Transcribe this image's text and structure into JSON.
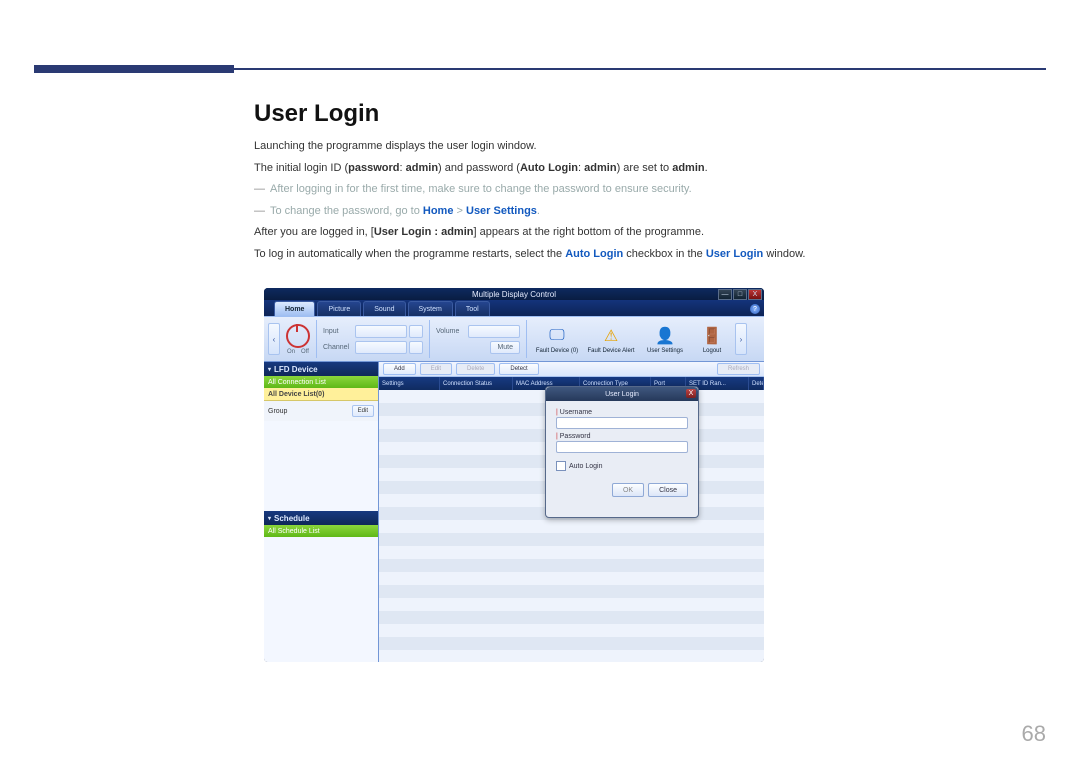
{
  "doc": {
    "heading": "User Login",
    "p1": "Launching the programme displays the user login window.",
    "p2_before": "The initial login ID (",
    "p2_pwd": "password",
    "p2_mid1": ": ",
    "p2_admin1": "admin",
    "p2_mid2": ") and password (",
    "p2_auto": "Auto Login",
    "p2_mid3": ": ",
    "p2_admin2": "admin",
    "p2_mid4": ") are set to ",
    "p2_admin3": "admin",
    "p2_end": ".",
    "dim1": "After logging in for the first time, make sure to change the password to ensure security.",
    "dim2_pre": "To change the password, go to ",
    "dim2_home": "Home",
    "dim2_gt": " > ",
    "dim2_us": "User Settings",
    "dim2_end": ".",
    "p3_pre": "After you are logged in, [",
    "p3_ul": "User Login : admin",
    "p3_mid": "] appears at the right bottom of the programme.",
    "p4_pre": "To log in automatically when the programme restarts, select the ",
    "p4_auto": "Auto Login",
    "p4_mid": " checkbox in the ",
    "p4_ul": "User Login",
    "p4_end": " window.",
    "page_number": "68"
  },
  "app": {
    "title": "Multiple Display Control",
    "help": "?",
    "tabs": {
      "home": "Home",
      "picture": "Picture",
      "sound": "Sound",
      "system": "System",
      "tool": "Tool"
    },
    "win": {
      "min": "—",
      "max": "□",
      "close": "X"
    },
    "ribbon": {
      "nav_left": "‹",
      "nav_right": "›",
      "on_label": "On",
      "off_label": "Off",
      "input_label": "Input",
      "channel_label": "Channel",
      "volume_label": "Volume",
      "mute_label": "Mute",
      "fault_device": "Fault Device (0)",
      "fault_alert": "Fault Device Alert",
      "user_settings": "User Settings",
      "logout": "Logout"
    },
    "sidebar": {
      "lfd": "LFD Device",
      "conn_list": "All Connection List",
      "device_list": "All Device List(0)",
      "group": "Group",
      "edit": "Edit",
      "schedule": "Schedule",
      "all_schedule": "All Schedule List"
    },
    "toolbar": {
      "add": "Add",
      "edit": "Edit",
      "delete": "Delete",
      "detect": "Detect",
      "refresh": "Refresh"
    },
    "grid": {
      "settings": "Settings",
      "connection_status": "Connection Status",
      "mac": "MAC Address",
      "conn_type": "Connection Type",
      "port": "Port",
      "set_id": "SET ID Ran...",
      "detected": "Detected"
    },
    "login": {
      "title": "User Login",
      "close": "X",
      "username": "Username",
      "password": "Password",
      "auto": "Auto Login",
      "ok": "OK",
      "closebtn": "Close"
    }
  }
}
